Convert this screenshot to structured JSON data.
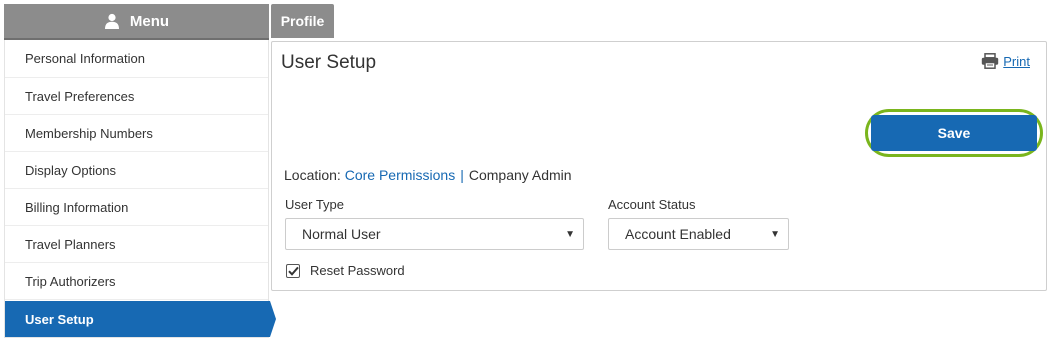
{
  "sidebar": {
    "header_label": "Menu",
    "header_icon": "user-icon",
    "items": [
      {
        "label": "Personal Information"
      },
      {
        "label": "Travel Preferences"
      },
      {
        "label": "Membership Numbers"
      },
      {
        "label": "Display Options"
      },
      {
        "label": "Billing Information"
      },
      {
        "label": "Travel Planners"
      },
      {
        "label": "Trip Authorizers"
      },
      {
        "label": "User Setup",
        "active": true
      }
    ]
  },
  "tabs": {
    "profile_label": "Profile"
  },
  "main": {
    "title": "User Setup",
    "print_label": "Print",
    "print_icon": "printer-icon",
    "save_label": "Save",
    "location": {
      "prefix": "Location:",
      "link": "Core Permissions",
      "separator": "|",
      "current": "Company Admin"
    },
    "user_type": {
      "label": "User Type",
      "value": "Normal User"
    },
    "account_status": {
      "label": "Account Status",
      "value": "Account Enabled"
    },
    "reset_password": {
      "label": "Reset Password",
      "checked": true
    }
  },
  "colors": {
    "accent": "#1769b3",
    "header_gray": "#8c8c8c",
    "highlight_ring": "#7ab51d"
  }
}
